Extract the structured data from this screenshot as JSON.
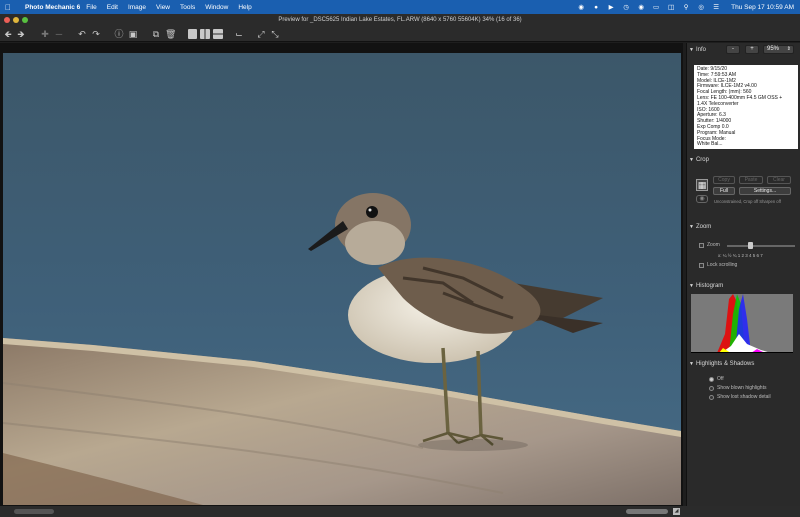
{
  "menubar": {
    "app_name": "Photo Mechanic 6",
    "menus": [
      "File",
      "Edit",
      "Image",
      "View",
      "Tools",
      "Window",
      "Help"
    ],
    "clock": "Thu Sep 17  10:59 AM"
  },
  "window": {
    "title": "Preview for  _DSC5625 Indian Lake Estates, FL.ARW (8640 x 5760 55604K) 34% (16 of 36)"
  },
  "panel": {
    "info": {
      "title": "Info",
      "zoom_minus": "-",
      "zoom_plus": "+",
      "zoom_value": "95%",
      "lines": [
        "Date: 9/15/20",
        "Time: 7:59:53 AM",
        "Model: ILCE-1M2",
        "Firmware: ILCE-1M2 v4.00",
        "Focal Length:  (mm): 560",
        "Lens: FE 100-400mm F4.5 GM OSS +",
        "1.4X Teleconverter",
        "ISO: 1600",
        "Aperture: 6.3",
        "Shutter: 1/4000",
        "Exp Comp 0.0",
        "Program: Manual",
        "Focus Mode:",
        "White Bal..."
      ]
    },
    "crop": {
      "title": "Crop",
      "copy": "Copy",
      "paste": "Paste",
      "clear": "Clear",
      "full": "Full",
      "settings": "Settings...",
      "status": "Unconstrained, Crop off  Sharpen off"
    },
    "zoom": {
      "title": "Zoom",
      "checkbox_label": "Zoom",
      "scale": "x:   ¼  ½  ¾  1   2   3   4   5   6   7",
      "lock_label": "Lock scrolling",
      "slider_level": 0.33
    },
    "histogram": {
      "title": "Histogram"
    },
    "highlights": {
      "title": "Highlights & Shadows",
      "options": [
        "Off",
        "Show blown highlights",
        "Show lost shadow detail"
      ],
      "selected": 0
    }
  },
  "colors": {
    "menubar": "#1a5fb0",
    "window": "#2b2b2b",
    "panel": "#2a2a2a",
    "sky": "#3d5a6e"
  }
}
